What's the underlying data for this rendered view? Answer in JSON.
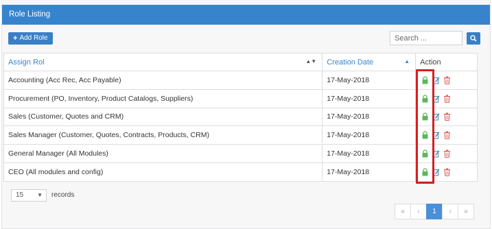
{
  "header": {
    "title": "Role Listing"
  },
  "toolbar": {
    "add_label": "Add Role"
  },
  "search": {
    "placeholder": "Search ..."
  },
  "table": {
    "columns": [
      {
        "label": "Assign Rol"
      },
      {
        "label": "Creation Date"
      },
      {
        "label": "Action"
      }
    ],
    "rows": [
      {
        "role": "Accounting (Acc Rec, Acc Payable)",
        "date": "17-May-2018"
      },
      {
        "role": "Procurement (PO, Inventory, Product Catalogs, Suppliers)",
        "date": "17-May-2018"
      },
      {
        "role": "Sales (Customer, Quotes and CRM)",
        "date": "17-May-2018"
      },
      {
        "role": "Sales Manager (Customer, Quotes, Contracts, Products, CRM)",
        "date": "17-May-2018"
      },
      {
        "role": "General Manager (All Modules)",
        "date": "17-May-2018"
      },
      {
        "role": "CEO (All modules and config)",
        "date": "17-May-2018"
      }
    ]
  },
  "footer": {
    "page_size": "15",
    "records_label": "records",
    "pagination": {
      "first": "«",
      "prev": "‹",
      "current": "1",
      "next": "›",
      "last": "»"
    }
  },
  "colors": {
    "header": "#3784cc",
    "lock": "#5cb85c",
    "edit": "#3a7fc6",
    "delete": "#e05a5a",
    "highlight": "#d41f1f"
  },
  "icons": [
    "plus-icon",
    "search-icon",
    "lock-icon",
    "edit-icon",
    "trash-icon"
  ]
}
